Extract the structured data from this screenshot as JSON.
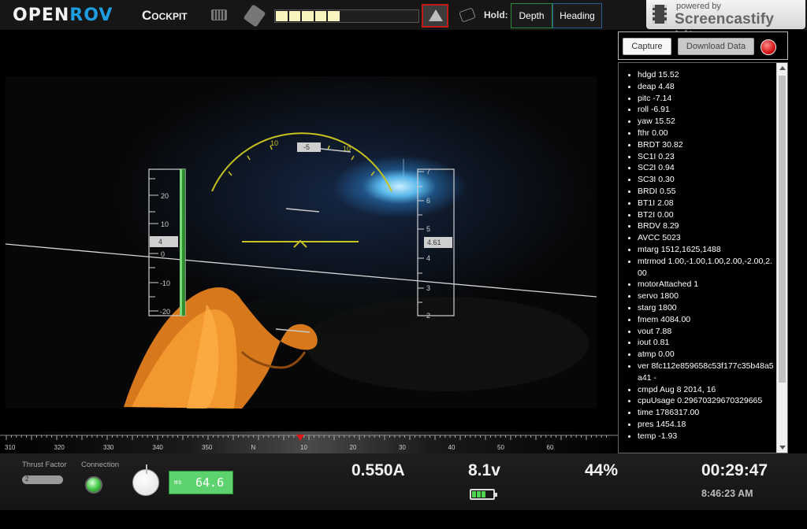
{
  "header": {
    "brand_open": "OPEN",
    "brand_rov": "ROV",
    "app_title": "Cockpit",
    "hold_label": "Hold:",
    "hold_depth_label": "Depth",
    "hold_heading_label": "Heading",
    "thrust_segments_on": 5,
    "thrust_segments_total": 11,
    "icons": [
      "keyboard-icon",
      "gamepad-icon",
      "lights-icon",
      "laser-icon"
    ]
  },
  "watermark": {
    "line1": "powered by",
    "line2": "Screencastify Lite"
  },
  "hud": {
    "depth_scale_labels": [
      "20",
      "10",
      "0",
      "-10",
      "-20"
    ],
    "depth_value": "4",
    "altitude_scale_labels": [
      "7",
      "6",
      "5",
      "4",
      "3",
      "2"
    ],
    "altitude_value": "4.61",
    "arc_labels": [
      "10",
      "10"
    ],
    "arc_value": "-5"
  },
  "panel": {
    "capture_label": "Capture",
    "download_label": "Download Data"
  },
  "telemetry": [
    "hdgd 15.52",
    "deap 4.48",
    "pitc -7.14",
    "roll -6.91",
    "yaw 15.52",
    "fthr 0.00",
    "BRDT 30.82",
    "SC1I 0.23",
    "SC2I 0.94",
    "SC3I 0.30",
    "BRDI 0.55",
    "BT1I 2.08",
    "BT2I 0.00",
    "BRDV 8.29",
    "AVCC 5023",
    "mtarg 1512,1625,1488",
    "mtrmod 1.00,-1.00,1.00,2.00,-2.00,2.00",
    "motorAttached 1",
    "servo 1800",
    "starg 1800",
    "fmem 4084.00",
    "vout 7.88",
    "iout 0.81",
    "atmp 0.00",
    "ver 8fc112e859658c53f177c35b48a5a41 -",
    "cmpd Aug 8 2014, 16",
    "cpuUsage 0.29670329670329665",
    "time 1786317.00",
    "pres 1454.18",
    "temp -1.93"
  ],
  "compass": {
    "labels": [
      "310",
      "320",
      "330",
      "340",
      "350",
      "N",
      "10",
      "20",
      "30",
      "40",
      "50",
      "60"
    ]
  },
  "footer": {
    "thrust_factor_label": "Thrust Factor",
    "thrust_factor_value": "2",
    "connection_label": "Connection",
    "latency_unit": "ms",
    "latency_value": "64.6",
    "current": "0.550A",
    "voltage": "8.1v",
    "battery_percent": "44%",
    "elapsed": "00:29:47",
    "clock": "8:46:23 AM"
  },
  "colors": {
    "hud_yellow": "#c8c21f",
    "brand_blue": "#1e9de0",
    "compass_marker": "#e01616",
    "depth_bar": "#2f8f2f"
  }
}
